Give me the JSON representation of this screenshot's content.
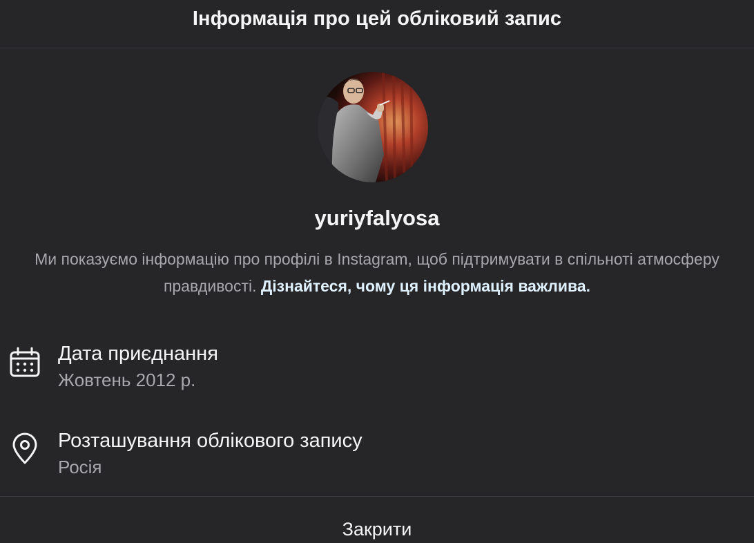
{
  "header": {
    "title": "Інформація про цей обліковий запис"
  },
  "profile": {
    "username": "yuriyfalyosa"
  },
  "description": {
    "text": "Ми показуємо інформацію про профілі в Instagram, щоб підтримувати в спільноті атмосферу правдивості. ",
    "link_text": "Дізнайтеся, чому ця інформація важлива."
  },
  "info": {
    "join_date": {
      "icon": "calendar-icon",
      "title": "Дата приєднання",
      "value": "Жовтень 2012 р."
    },
    "location": {
      "icon": "location-pin-icon",
      "title": "Розташування облікового запису",
      "value": "Росія"
    }
  },
  "footer": {
    "close_label": "Закрити"
  },
  "colors": {
    "background": "#262629",
    "divider": "#3d3d42",
    "primary_text": "#f5f5f5",
    "secondary_text": "#a8a8ad",
    "link": "#e0f1ff"
  }
}
